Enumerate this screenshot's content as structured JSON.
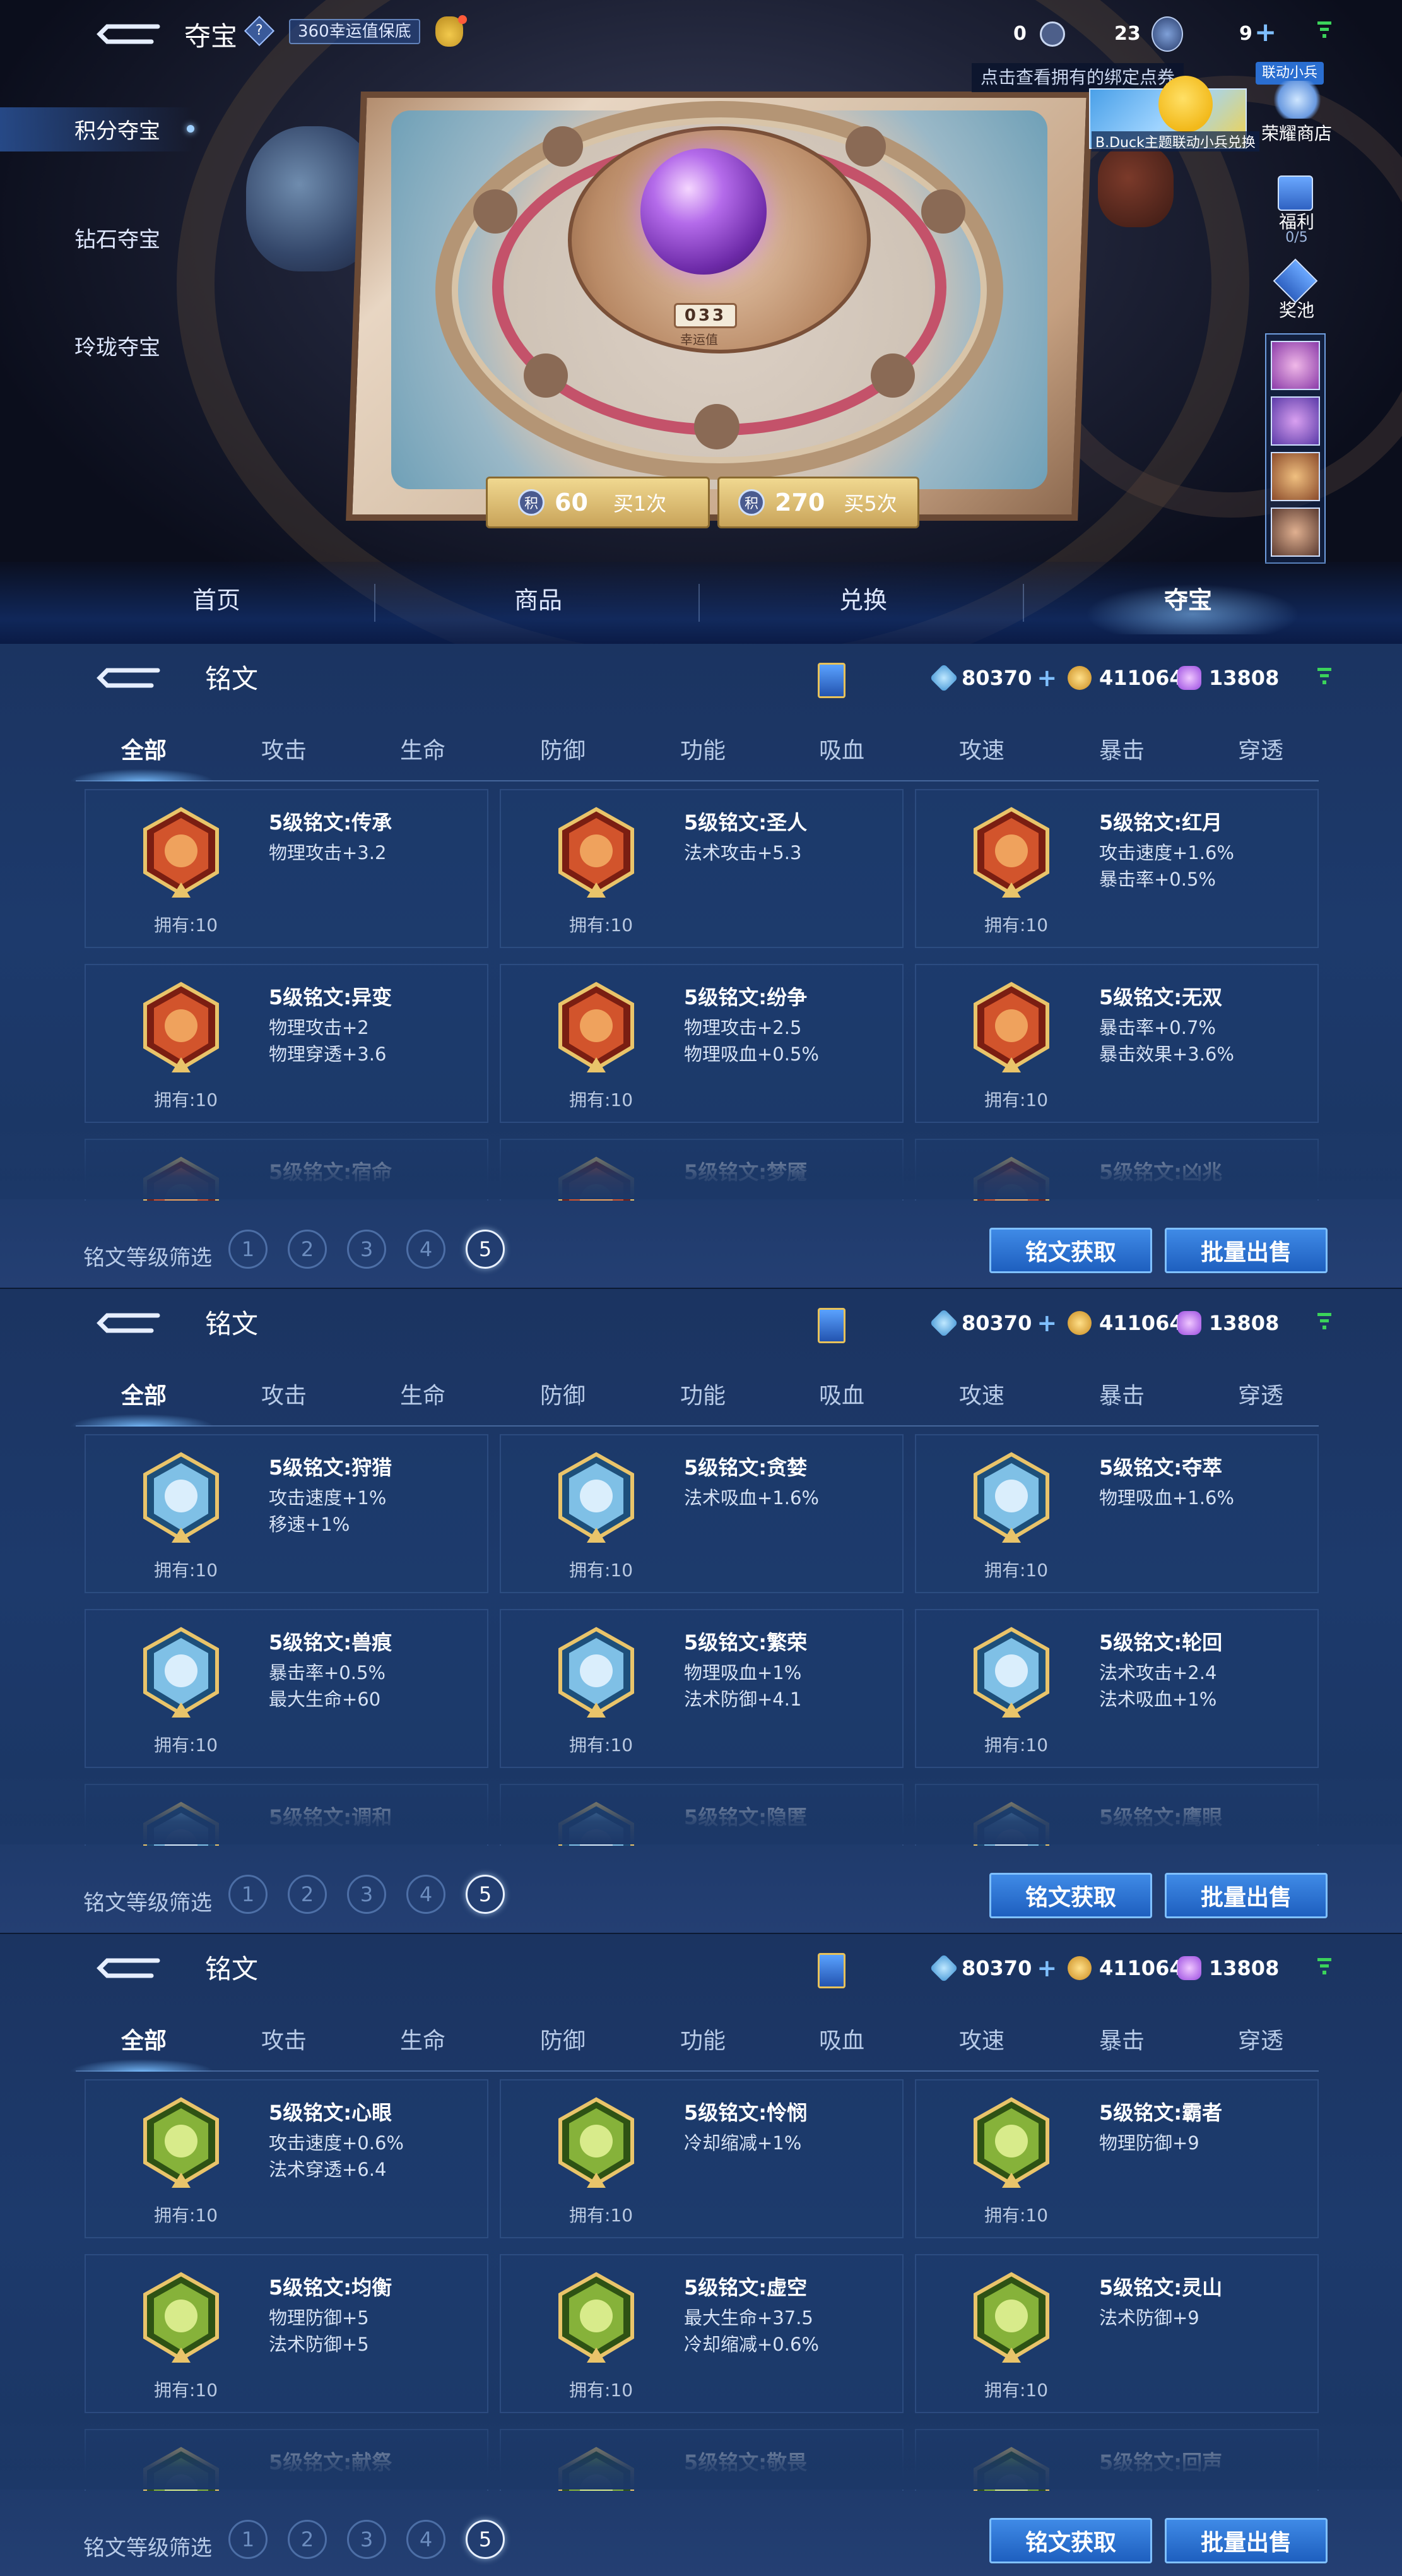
{
  "treasure": {
    "title": "夺宝",
    "help": "?",
    "luck_tag": "360幸运值保底",
    "resource_1": "0",
    "resource_2": "23",
    "resource_3": "9",
    "plus": "+",
    "side_tabs": [
      "积分夺宝",
      "钻石夺宝",
      "玲珑夺宝"
    ],
    "tooltip": "点击查看拥有的绑定点券",
    "promo_tag": "联动小兵",
    "promo_caption": "B.Duck主题联动小兵兑换",
    "honor_shop": "荣耀商店",
    "welfare": "福利",
    "welfare_count": "0/5",
    "prize_pool": "奖池",
    "luck_counter": "033",
    "luck_label": "幸运值",
    "buy_one": {
      "price": "60",
      "label": "买1次",
      "coin": "积"
    },
    "buy_five": {
      "price": "270",
      "label": "买5次",
      "coin": "积"
    },
    "nav": [
      "首页",
      "商品",
      "兑换",
      "夺宝"
    ]
  },
  "panels": [
    {
      "title": "铭文",
      "currency": {
        "a": "80370",
        "b": "411064",
        "c": "13808"
      },
      "tabs": [
        "全部",
        "攻击",
        "生命",
        "防御",
        "功能",
        "吸血",
        "攻速",
        "暴击",
        "穿透"
      ],
      "theme": "red",
      "cards": [
        {
          "name": "5级铭文:传承",
          "s1": "物理攻击+3.2",
          "s2": "",
          "own": "拥有:10"
        },
        {
          "name": "5级铭文:圣人",
          "s1": "法术攻击+5.3",
          "s2": "",
          "own": "拥有:10"
        },
        {
          "name": "5级铭文:红月",
          "s1": "攻击速度+1.6%",
          "s2": "暴击率+0.5%",
          "own": "拥有:10"
        },
        {
          "name": "5级铭文:异变",
          "s1": "物理攻击+2",
          "s2": "物理穿透+3.6",
          "own": "拥有:10"
        },
        {
          "name": "5级铭文:纷争",
          "s1": "物理攻击+2.5",
          "s2": "物理吸血+0.5%",
          "own": "拥有:10"
        },
        {
          "name": "5级铭文:无双",
          "s1": "暴击率+0.7%",
          "s2": "暴击效果+3.6%",
          "own": "拥有:10"
        },
        {
          "name": "5级铭文:宿命",
          "s1": "",
          "s2": "",
          "own": ""
        },
        {
          "name": "5级铭文:梦魇",
          "s1": "",
          "s2": "",
          "own": ""
        },
        {
          "name": "5级铭文:凶兆",
          "s1": "",
          "s2": "",
          "own": ""
        }
      ],
      "filter_label": "铭文等级筛选",
      "levels": [
        "1",
        "2",
        "3",
        "4",
        "5"
      ],
      "btn_get": "铭文获取",
      "btn_sell": "批量出售"
    },
    {
      "title": "铭文",
      "currency": {
        "a": "80370",
        "b": "411064",
        "c": "13808"
      },
      "tabs": [
        "全部",
        "攻击",
        "生命",
        "防御",
        "功能",
        "吸血",
        "攻速",
        "暴击",
        "穿透"
      ],
      "theme": "blue",
      "cards": [
        {
          "name": "5级铭文:狩猎",
          "s1": "攻击速度+1%",
          "s2": "移速+1%",
          "own": "拥有:10"
        },
        {
          "name": "5级铭文:贪婪",
          "s1": "法术吸血+1.6%",
          "s2": "",
          "own": "拥有:10"
        },
        {
          "name": "5级铭文:夺萃",
          "s1": "物理吸血+1.6%",
          "s2": "",
          "own": "拥有:10"
        },
        {
          "name": "5级铭文:兽痕",
          "s1": "暴击率+0.5%",
          "s2": "最大生命+60",
          "own": "拥有:10"
        },
        {
          "name": "5级铭文:繁荣",
          "s1": "物理吸血+1%",
          "s2": "法术防御+4.1",
          "own": "拥有:10"
        },
        {
          "name": "5级铭文:轮回",
          "s1": "法术攻击+2.4",
          "s2": "法术吸血+1%",
          "own": "拥有:10"
        },
        {
          "name": "5级铭文:调和",
          "s1": "",
          "s2": "",
          "own": ""
        },
        {
          "name": "5级铭文:隐匿",
          "s1": "",
          "s2": "",
          "own": ""
        },
        {
          "name": "5级铭文:鹰眼",
          "s1": "",
          "s2": "",
          "own": ""
        }
      ],
      "filter_label": "铭文等级筛选",
      "levels": [
        "1",
        "2",
        "3",
        "4",
        "5"
      ],
      "btn_get": "铭文获取",
      "btn_sell": "批量出售"
    },
    {
      "title": "铭文",
      "currency": {
        "a": "80370",
        "b": "411064",
        "c": "13808"
      },
      "tabs": [
        "全部",
        "攻击",
        "生命",
        "防御",
        "功能",
        "吸血",
        "攻速",
        "暴击",
        "穿透"
      ],
      "theme": "green",
      "cards": [
        {
          "name": "5级铭文:心眼",
          "s1": "攻击速度+0.6%",
          "s2": "法术穿透+6.4",
          "own": "拥有:10"
        },
        {
          "name": "5级铭文:怜悯",
          "s1": "冷却缩减+1%",
          "s2": "",
          "own": "拥有:10"
        },
        {
          "name": "5级铭文:霸者",
          "s1": "物理防御+9",
          "s2": "",
          "own": "拥有:10"
        },
        {
          "name": "5级铭文:均衡",
          "s1": "物理防御+5",
          "s2": "法术防御+5",
          "own": "拥有:10"
        },
        {
          "name": "5级铭文:虚空",
          "s1": "最大生命+37.5",
          "s2": "冷却缩减+0.6%",
          "own": "拥有:10"
        },
        {
          "name": "5级铭文:灵山",
          "s1": "法术防御+9",
          "s2": "",
          "own": "拥有:10"
        },
        {
          "name": "5级铭文:献祭",
          "s1": "",
          "s2": "",
          "own": ""
        },
        {
          "name": "5级铭文:敬畏",
          "s1": "",
          "s2": "",
          "own": ""
        },
        {
          "name": "5级铭文:回声",
          "s1": "",
          "s2": "",
          "own": ""
        }
      ],
      "filter_label": "铭文等级筛选",
      "levels": [
        "1",
        "2",
        "3",
        "4",
        "5"
      ],
      "btn_get": "铭文获取",
      "btn_sell": "批量出售"
    }
  ],
  "colors": {
    "red": "#c2442a",
    "blue": "#6fb3d8",
    "green": "#7fae3a",
    "gold": "#d9b25c"
  }
}
